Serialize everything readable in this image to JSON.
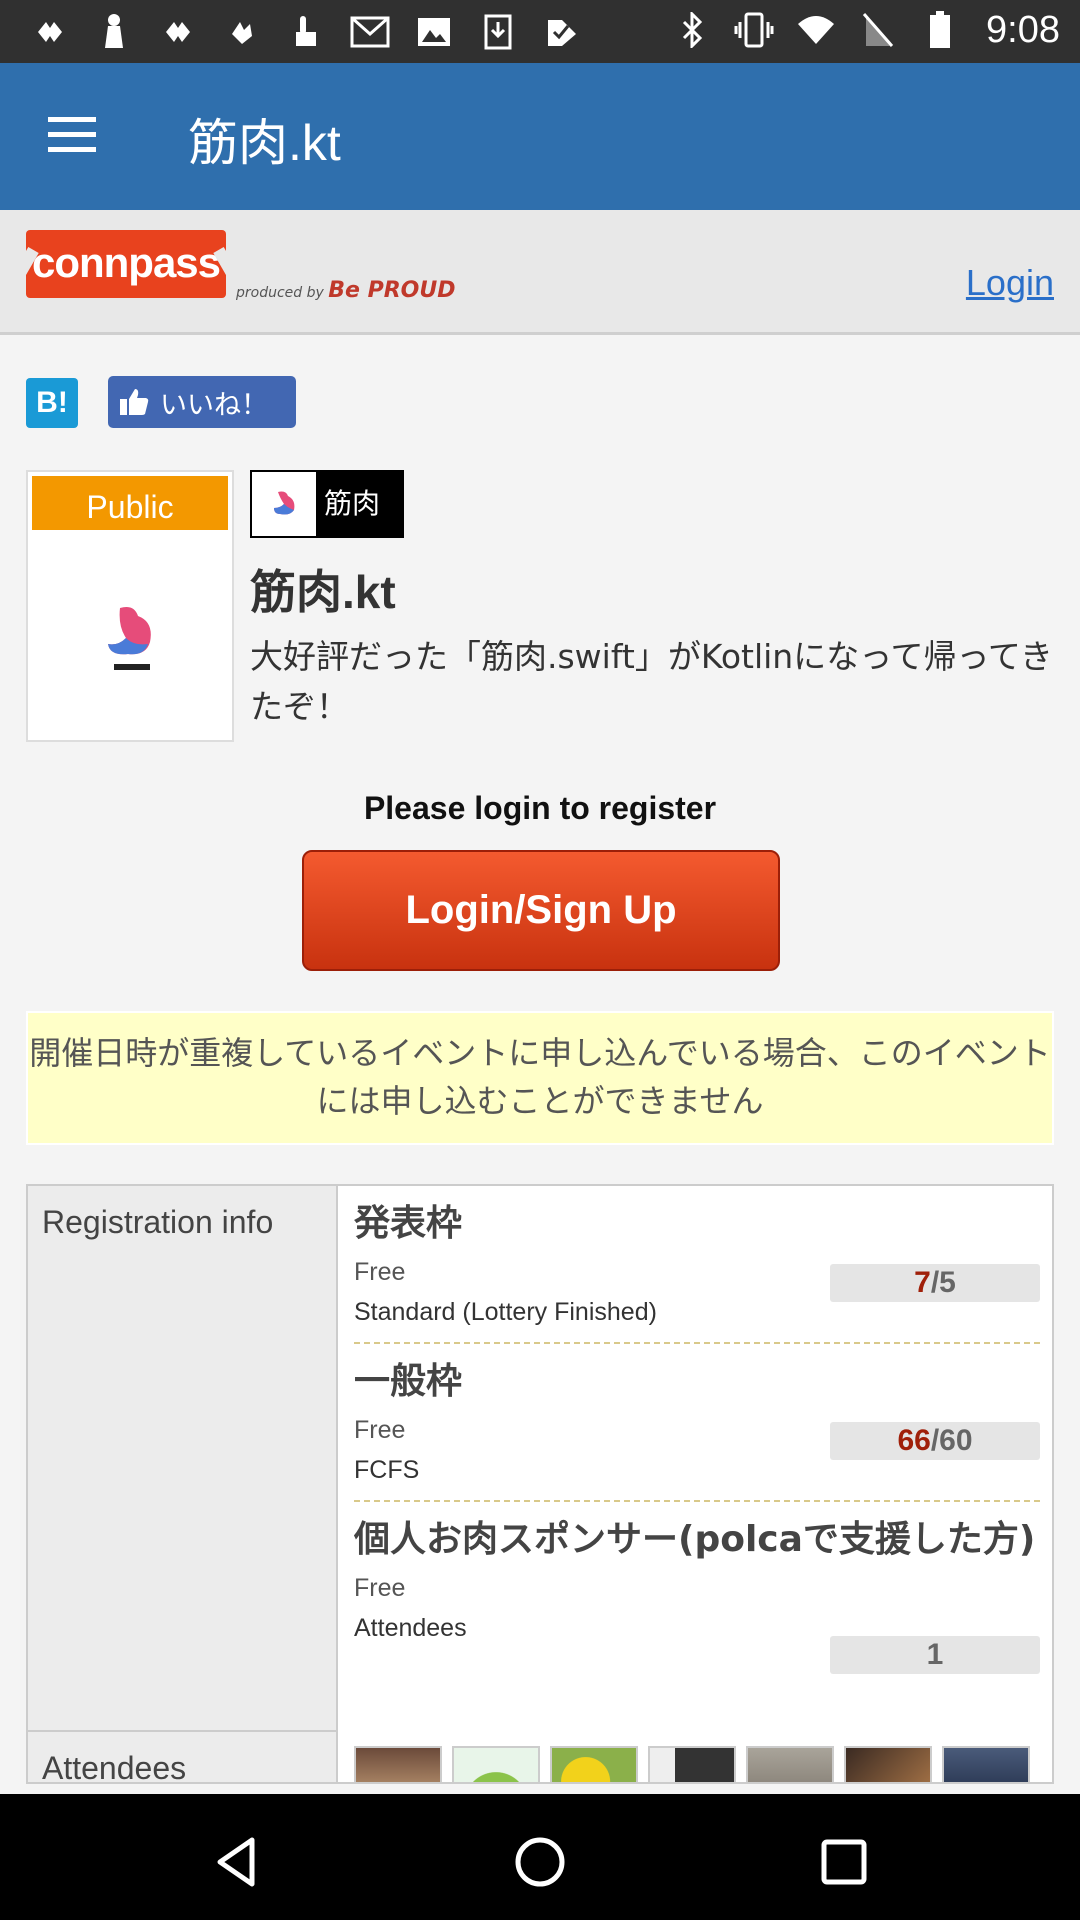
{
  "status_bar": {
    "time": "9:08",
    "left_icons": [
      "app-icon",
      "chess-icon",
      "app-icon",
      "app-icon",
      "touch-icon",
      "mail-icon",
      "image-icon",
      "download-icon",
      "check-icon"
    ],
    "right_icons": [
      "bluetooth-icon",
      "vibrate-icon",
      "wifi-icon",
      "no-sim-icon",
      "battery-icon"
    ]
  },
  "app_bar": {
    "title": "筋肉.kt"
  },
  "site_header": {
    "logo": "connpass",
    "produced_by": "produced by",
    "produced_by_brand": "Be PROUD",
    "login": "Login"
  },
  "social": {
    "hatena": "B!",
    "like": "いいね！"
  },
  "event": {
    "public_label": "Public",
    "group_name": "筋肉",
    "title": "筋肉.kt",
    "description": "大好評だった「筋肉.swift」がKotlinになって帰ってきたぞ！"
  },
  "register": {
    "prompt": "Please login to register",
    "button": "Login/Sign Up"
  },
  "notice": "開催日時が重複しているイベントに申し込んでいる場合、このイベントには申し込むことができません",
  "registration": {
    "label": "Registration info",
    "attendees_label": "Attendees",
    "tickets": [
      {
        "name": "発表枠",
        "fee": "Free",
        "type": "Standard (Lottery Finished)",
        "current": "7",
        "capacity": "/5"
      },
      {
        "name": "一般枠",
        "fee": "Free",
        "type": "FCFS",
        "current": "66",
        "capacity": "/60"
      },
      {
        "name": "個人お肉スポンサー(polcaで支援した方)",
        "fee": "Free",
        "type": "Attendees",
        "current": "",
        "capacity": "1"
      }
    ]
  },
  "colors": {
    "app_bar": "#2f6fad",
    "accent": "#e8421e",
    "button": "#d63c15",
    "notice_bg": "#ffffc8"
  }
}
